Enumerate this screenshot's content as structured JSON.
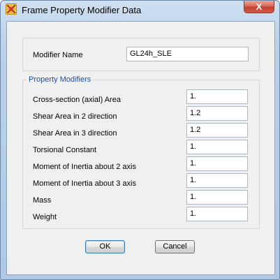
{
  "window": {
    "title": "Frame Property Modifier Data",
    "close_label": "X",
    "icon": "app-logo-icon"
  },
  "modifier_name": {
    "label": "Modifier Name",
    "value": "GL24h_SLE"
  },
  "property_modifiers": {
    "group_label": "Property Modifiers",
    "rows": [
      {
        "label": "Cross-section (axial) Area",
        "value": "1."
      },
      {
        "label": "Shear Area in 2 direction",
        "value": "1.2"
      },
      {
        "label": "Shear Area in 3 direction",
        "value": "1.2"
      },
      {
        "label": "Torsional Constant",
        "value": "1."
      },
      {
        "label": "Moment of Inertia about 2 axis",
        "value": "1."
      },
      {
        "label": "Moment of Inertia about 3 axis",
        "value": "1."
      },
      {
        "label": "Mass",
        "value": "1."
      },
      {
        "label": "Weight",
        "value": "1."
      }
    ]
  },
  "buttons": {
    "ok": "OK",
    "cancel": "Cancel"
  }
}
